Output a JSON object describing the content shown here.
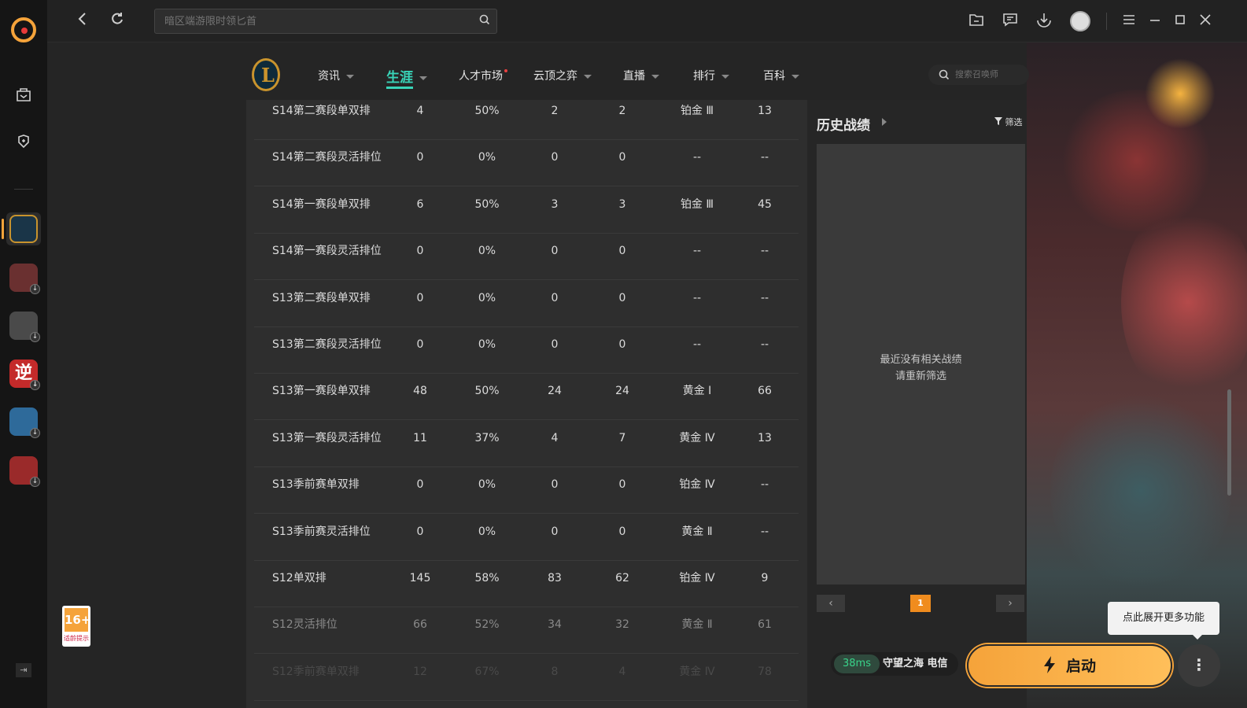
{
  "topbar": {
    "search_placeholder": "暗区端游限时领匕首",
    "back_icon": "back-arrow-icon",
    "refresh_icon": "refresh-icon"
  },
  "nav": {
    "items": [
      {
        "label": "资讯",
        "has_dropdown": true
      },
      {
        "label": "生涯",
        "has_dropdown": true,
        "active": true
      },
      {
        "label": "人才市场",
        "has_dropdown": false,
        "badge_dot": true
      },
      {
        "label": "云顶之弈",
        "has_dropdown": true
      },
      {
        "label": "直播",
        "has_dropdown": true
      },
      {
        "label": "排行",
        "has_dropdown": true
      },
      {
        "label": "百科",
        "has_dropdown": true
      }
    ],
    "summoner_search_placeholder": "搜索召唤师"
  },
  "ranked_table": {
    "rows": [
      [
        "S14第二赛段单双排",
        "4",
        "50%",
        "2",
        "2",
        "铂金 Ⅲ",
        "13"
      ],
      [
        "S14第二赛段灵活排位",
        "0",
        "0%",
        "0",
        "0",
        "--",
        "--"
      ],
      [
        "S14第一赛段单双排",
        "6",
        "50%",
        "3",
        "3",
        "铂金 Ⅲ",
        "45"
      ],
      [
        "S14第一赛段灵活排位",
        "0",
        "0%",
        "0",
        "0",
        "--",
        "--"
      ],
      [
        "S13第二赛段单双排",
        "0",
        "0%",
        "0",
        "0",
        "--",
        "--"
      ],
      [
        "S13第二赛段灵活排位",
        "0",
        "0%",
        "0",
        "0",
        "--",
        "--"
      ],
      [
        "S13第一赛段单双排",
        "48",
        "50%",
        "24",
        "24",
        "黄金 Ⅰ",
        "66"
      ],
      [
        "S13第一赛段灵活排位",
        "11",
        "37%",
        "4",
        "7",
        "黄金 Ⅳ",
        "13"
      ],
      [
        "S13季前赛单双排",
        "0",
        "0%",
        "0",
        "0",
        "铂金 Ⅳ",
        "--"
      ],
      [
        "S13季前赛灵活排位",
        "0",
        "0%",
        "0",
        "0",
        "黄金 Ⅱ",
        "--"
      ],
      [
        "S12单双排",
        "145",
        "58%",
        "83",
        "62",
        "铂金 Ⅳ",
        "9"
      ],
      [
        "S12灵活排位",
        "66",
        "52%",
        "34",
        "32",
        "黄金 Ⅱ",
        "61"
      ],
      [
        "S12季前赛单双排",
        "12",
        "67%",
        "8",
        "4",
        "黄金 Ⅳ",
        "78"
      ]
    ]
  },
  "history": {
    "title": "历史战绩",
    "filter_label": "筛选",
    "empty_line1": "最近没有相关战绩",
    "empty_line2": "请重新筛选",
    "page": "1",
    "prev": "‹",
    "next": "›"
  },
  "bottom": {
    "ping": "38ms",
    "server": "守望之海 电信",
    "launch_label": "启动",
    "more_label": "⋮",
    "tooltip": "点此展开更多功能"
  },
  "age_badge": {
    "top": "16+",
    "bottom": "适龄提示"
  },
  "colors": {
    "accent": "#39d4b8",
    "brand": "#f5a33a"
  }
}
